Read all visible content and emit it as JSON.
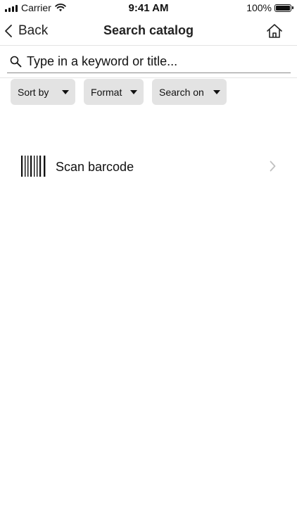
{
  "status_bar": {
    "carrier": "Carrier",
    "time": "9:41 AM",
    "battery_percent": "100%",
    "battery_level": 1.0
  },
  "nav": {
    "back_label": "Back",
    "title": "Search catalog",
    "back_icon": "chevron-left-icon",
    "home_icon": "home-icon"
  },
  "search": {
    "placeholder": "Type in a keyword or title...",
    "value": "",
    "icon": "search-icon"
  },
  "filters": [
    {
      "label": "Sort by"
    },
    {
      "label": "Format"
    },
    {
      "label": "Search on"
    }
  ],
  "scan": {
    "label": "Scan barcode",
    "icon": "barcode-icon"
  },
  "colors": {
    "text": "#111111",
    "filter_bg": "#e3e3e3",
    "chevron": "#c0c0c0",
    "divider": "#e6e6e6"
  }
}
